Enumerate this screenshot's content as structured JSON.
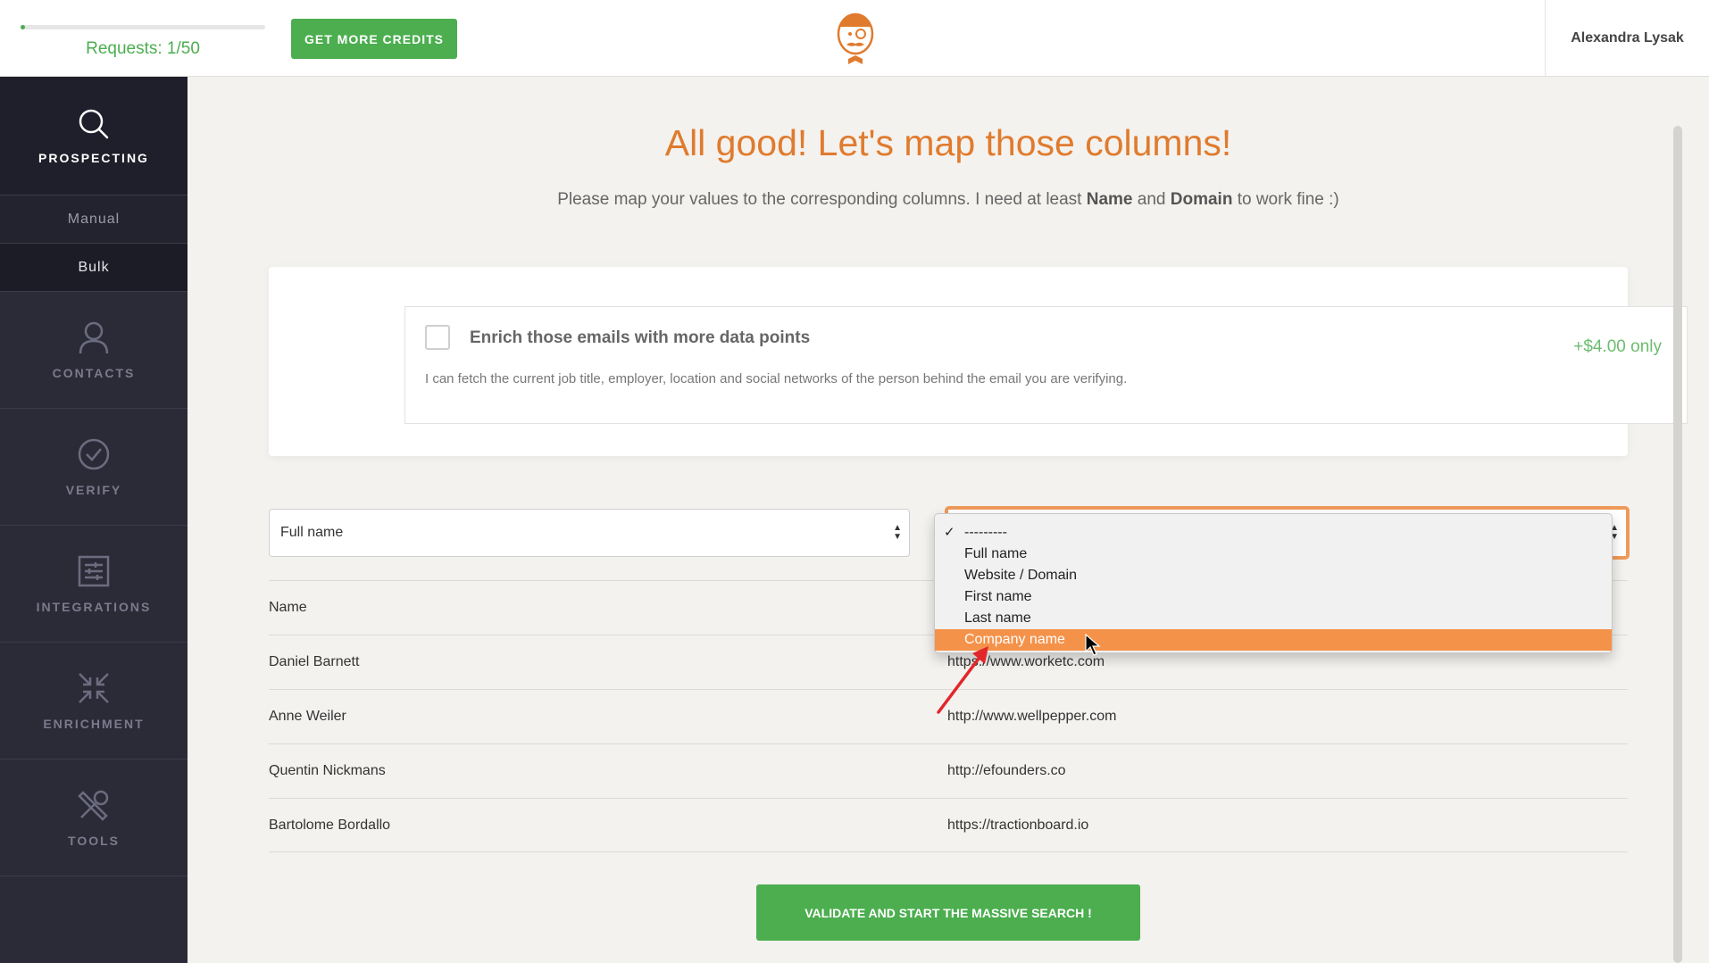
{
  "header": {
    "requests_label": "Requests: 1/50",
    "requests_progress": 0.02,
    "credits_button": "GET MORE CREDITS",
    "user_name": "Alexandra Lysak"
  },
  "sidebar": {
    "prospecting": "PROSPECTING",
    "sub_items": [
      "Manual",
      "Bulk"
    ],
    "items": [
      {
        "label": "CONTACTS",
        "icon": "user-icon"
      },
      {
        "label": "VERIFY",
        "icon": "check-circle-icon"
      },
      {
        "label": "INTEGRATIONS",
        "icon": "sliders-icon"
      },
      {
        "label": "ENRICHMENT",
        "icon": "compress-arrows-icon"
      },
      {
        "label": "TOOLS",
        "icon": "tools-icon"
      }
    ]
  },
  "main": {
    "title": "All good! Let's map those columns!",
    "subtitle_before": "Please map your values to the corresponding columns. I need at least ",
    "subtitle_bold1": "Name",
    "subtitle_mid": " and ",
    "subtitle_bold2": "Domain",
    "subtitle_after": " to work fine :)",
    "enrich": {
      "title": "Enrich those emails with more data points",
      "price": "+$4.00 only",
      "description": "I can fetch the current job title, employer, location and social networks of the person behind the email you are verifying."
    },
    "left_select_value": "Full name",
    "dropdown_options": [
      "---------",
      "Full name",
      "Website / Domain",
      "First name",
      "Last name",
      "Company name"
    ],
    "dropdown_highlighted": "Company name",
    "rows": [
      {
        "a": "Name",
        "b": ""
      },
      {
        "a": "Daniel Barnett",
        "b": "https://www.worketc.com"
      },
      {
        "a": "Anne Weiler",
        "b": "http://www.wellpepper.com"
      },
      {
        "a": "Quentin Nickmans",
        "b": "http://efounders.co"
      },
      {
        "a": "Bartolome Bordallo",
        "b": "https://tractionboard.io"
      }
    ],
    "validate_button": "VALIDATE AND START THE MASSIVE SEARCH !"
  },
  "colors": {
    "accent_green": "#4cae4f",
    "accent_orange": "#e07b2e",
    "sidebar_bg": "#2b2b38"
  }
}
